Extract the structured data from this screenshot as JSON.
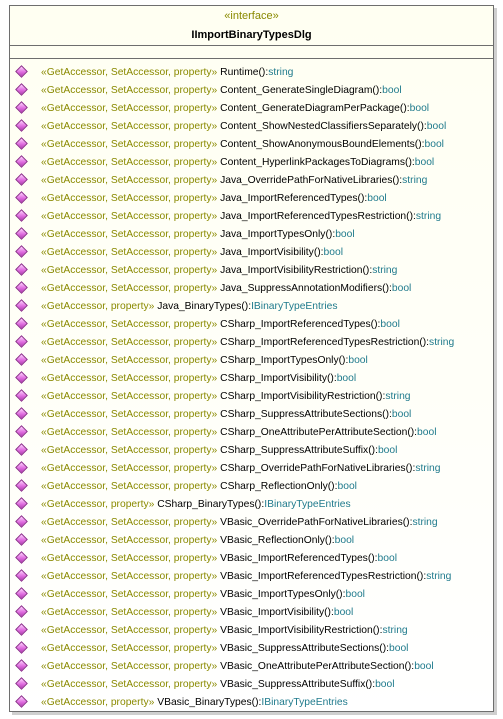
{
  "interface": {
    "stereotype": "«interface»",
    "name": "IImportBinaryTypesDlg"
  },
  "operations": [
    {
      "stereo": "«GetAccessor, SetAccessor, property»",
      "name": "Runtime():",
      "type": "string"
    },
    {
      "stereo": "«GetAccessor, SetAccessor, property»",
      "name": "Content_GenerateSingleDiagram():",
      "type": "bool"
    },
    {
      "stereo": "«GetAccessor, SetAccessor, property»",
      "name": "Content_GenerateDiagramPerPackage():",
      "type": "bool"
    },
    {
      "stereo": "«GetAccessor, SetAccessor, property»",
      "name": "Content_ShowNestedClassifiersSeparately():",
      "type": "bool"
    },
    {
      "stereo": "«GetAccessor, SetAccessor, property»",
      "name": "Content_ShowAnonymousBoundElements():",
      "type": "bool"
    },
    {
      "stereo": "«GetAccessor, SetAccessor, property»",
      "name": "Content_HyperlinkPackagesToDiagrams():",
      "type": "bool"
    },
    {
      "stereo": "«GetAccessor, SetAccessor, property»",
      "name": "Java_OverridePathForNativeLibraries():",
      "type": "string"
    },
    {
      "stereo": "«GetAccessor, SetAccessor, property»",
      "name": "Java_ImportReferencedTypes():",
      "type": "bool"
    },
    {
      "stereo": "«GetAccessor, SetAccessor, property»",
      "name": "Java_ImportReferencedTypesRestriction():",
      "type": "string"
    },
    {
      "stereo": "«GetAccessor, SetAccessor, property»",
      "name": "Java_ImportTypesOnly():",
      "type": "bool"
    },
    {
      "stereo": "«GetAccessor, SetAccessor, property»",
      "name": "Java_ImportVisibility():",
      "type": "bool"
    },
    {
      "stereo": "«GetAccessor, SetAccessor, property»",
      "name": "Java_ImportVisibilityRestriction():",
      "type": "string"
    },
    {
      "stereo": "«GetAccessor, SetAccessor, property»",
      "name": "Java_SuppressAnnotationModifiers():",
      "type": "bool"
    },
    {
      "stereo": "«GetAccessor, property»",
      "name": "Java_BinaryTypes():",
      "type": "IBinaryTypeEntries"
    },
    {
      "stereo": "«GetAccessor, SetAccessor, property»",
      "name": "CSharp_ImportReferencedTypes():",
      "type": "bool"
    },
    {
      "stereo": "«GetAccessor, SetAccessor, property»",
      "name": "CSharp_ImportReferencedTypesRestriction():",
      "type": "string"
    },
    {
      "stereo": "«GetAccessor, SetAccessor, property»",
      "name": "CSharp_ImportTypesOnly():",
      "type": "bool"
    },
    {
      "stereo": "«GetAccessor, SetAccessor, property»",
      "name": "CSharp_ImportVisibility():",
      "type": "bool"
    },
    {
      "stereo": "«GetAccessor, SetAccessor, property»",
      "name": "CSharp_ImportVisibilityRestriction():",
      "type": "string"
    },
    {
      "stereo": "«GetAccessor, SetAccessor, property»",
      "name": "CSharp_SuppressAttributeSections():",
      "type": "bool"
    },
    {
      "stereo": "«GetAccessor, SetAccessor, property»",
      "name": "CSharp_OneAttributePerAttributeSection():",
      "type": "bool"
    },
    {
      "stereo": "«GetAccessor, SetAccessor, property»",
      "name": "CSharp_SuppressAttributeSuffix():",
      "type": "bool"
    },
    {
      "stereo": "«GetAccessor, SetAccessor, property»",
      "name": "CSharp_OverridePathForNativeLibraries():",
      "type": "string"
    },
    {
      "stereo": "«GetAccessor, SetAccessor, property»",
      "name": "CSharp_ReflectionOnly():",
      "type": "bool"
    },
    {
      "stereo": "«GetAccessor, property»",
      "name": "CSharp_BinaryTypes():",
      "type": "IBinaryTypeEntries"
    },
    {
      "stereo": "«GetAccessor, SetAccessor, property»",
      "name": "VBasic_OverridePathForNativeLibraries():",
      "type": "string"
    },
    {
      "stereo": "«GetAccessor, SetAccessor, property»",
      "name": "VBasic_ReflectionOnly():",
      "type": "bool"
    },
    {
      "stereo": "«GetAccessor, SetAccessor, property»",
      "name": "VBasic_ImportReferencedTypes():",
      "type": "bool"
    },
    {
      "stereo": "«GetAccessor, SetAccessor, property»",
      "name": "VBasic_ImportReferencedTypesRestriction():",
      "type": "string"
    },
    {
      "stereo": "«GetAccessor, SetAccessor, property»",
      "name": "VBasic_ImportTypesOnly():",
      "type": "bool"
    },
    {
      "stereo": "«GetAccessor, SetAccessor, property»",
      "name": "VBasic_ImportVisibility():",
      "type": "bool"
    },
    {
      "stereo": "«GetAccessor, SetAccessor, property»",
      "name": "VBasic_ImportVisibilityRestriction():",
      "type": "string"
    },
    {
      "stereo": "«GetAccessor, SetAccessor, property»",
      "name": "VBasic_SuppressAttributeSections():",
      "type": "bool"
    },
    {
      "stereo": "«GetAccessor, SetAccessor, property»",
      "name": "VBasic_OneAttributePerAttributeSection():",
      "type": "bool"
    },
    {
      "stereo": "«GetAccessor, SetAccessor, property»",
      "name": "VBasic_SuppressAttributeSuffix():",
      "type": "bool"
    },
    {
      "stereo": "«GetAccessor, property»",
      "name": "VBasic_BinaryTypes():",
      "type": "IBinaryTypeEntries"
    }
  ],
  "icon": "operation-diamond-icon",
  "colors": {
    "stereotype": "#8a8a00",
    "name": "#000000",
    "type": "#1f7a8c",
    "icon": "#e06ee0",
    "border": "#6e6e6e"
  }
}
